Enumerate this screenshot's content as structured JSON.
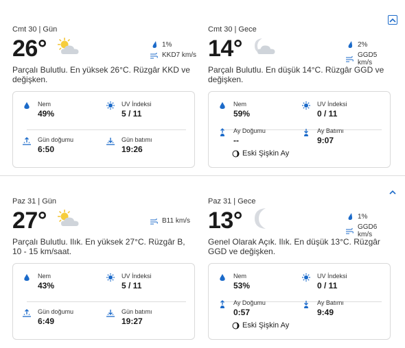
{
  "colors": {
    "accent": "#1b6ac9",
    "sun": "#f2c230",
    "cloud": "#cfd4da",
    "moon": "#d8dbe0"
  },
  "blocks": [
    {
      "day": {
        "label": "Cmt 30 | Gün",
        "temp": "26°",
        "icon": "partly-cloudy-day-icon",
        "precip": "1%",
        "wind": "KKD7 km/s",
        "desc": "Parçalı Bulutlu. En yüksek 26°C. Rüzgâr KKD ve değişken.",
        "humidity_label": "Nem",
        "humidity": "49%",
        "uv_label": "UV İndeksi",
        "uv": "5 / 11",
        "rise_label": "Gün doğumu",
        "rise": "6:50",
        "set_label": "Gün batımı",
        "set": "19:26"
      },
      "night": {
        "label": "Cmt 30 | Gece",
        "temp": "14°",
        "icon": "partly-cloudy-night-icon",
        "precip": "2%",
        "wind": "GGD5 km/s",
        "desc": "Parçalı Bulutlu. En düşük 14°C. Rüzgâr GGD ve değişken.",
        "humidity_label": "Nem",
        "humidity": "59%",
        "uv_label": "UV İndeksi",
        "uv": "0 / 11",
        "rise_label": "Ay Doğumu",
        "rise": "--",
        "set_label": "Ay Batımı",
        "set": "9:07",
        "moon_phase": "Eski Şişkin Ay"
      }
    },
    {
      "day": {
        "label": "Paz 31 | Gün",
        "temp": "27°",
        "icon": "partly-cloudy-day-icon",
        "wind": "B11 km/s",
        "desc": "Parçalı Bulutlu. Ilık. En yüksek 27°C. Rüzgâr B, 10 - 15 km/saat.",
        "humidity_label": "Nem",
        "humidity": "43%",
        "uv_label": "UV İndeksi",
        "uv": "5 / 11",
        "rise_label": "Gün doğumu",
        "rise": "6:49",
        "set_label": "Gün batımı",
        "set": "19:27"
      },
      "night": {
        "label": "Paz 31 | Gece",
        "temp": "13°",
        "icon": "clear-night-icon",
        "precip": "1%",
        "wind": "GGD6 km/s",
        "desc": "Genel Olarak Açık. Ilık. En düşük 13°C. Rüzgâr GGD ve değişken.",
        "humidity_label": "Nem",
        "humidity": "53%",
        "uv_label": "UV İndeksi",
        "uv": "0 / 11",
        "rise_label": "Ay Doğumu",
        "rise": "0:57",
        "set_label": "Ay Batımı",
        "set": "9:49",
        "moon_phase": "Eski Şişkin Ay"
      }
    }
  ]
}
